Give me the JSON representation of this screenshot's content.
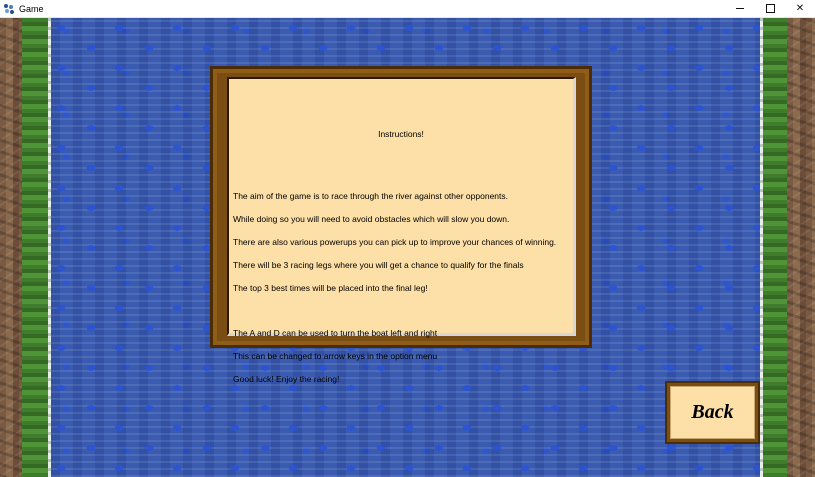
{
  "window": {
    "title": "Game",
    "icon": "game-app-icon",
    "controls": {
      "minimize": "minimize-icon",
      "maximize": "maximize-icon",
      "close": "✕"
    }
  },
  "instructions": {
    "title": "Instructions!",
    "paragraph1": [
      "The aim of the game is to race through the river against other opponents.",
      "While doing so you will need to avoid obstacles which will slow you down.",
      "There are also various powerups you can pick up to improve your chances of winning.",
      "There will be 3 racing legs where you will get a chance to qualify for the finals",
      "The top 3 best times will be placed into the final leg!"
    ],
    "paragraph2": [
      "The A and D can be used to turn the boat left and right",
      "This can be changed to arrow keys in the option menu",
      "Good luck! Enjoy the racing!"
    ]
  },
  "back_button": {
    "label": "Back"
  },
  "colors": {
    "panel_bg": "#fddfa8",
    "frame": "#7a4e12",
    "water": "#3a5bb0",
    "grass": "#3f7d2c"
  }
}
